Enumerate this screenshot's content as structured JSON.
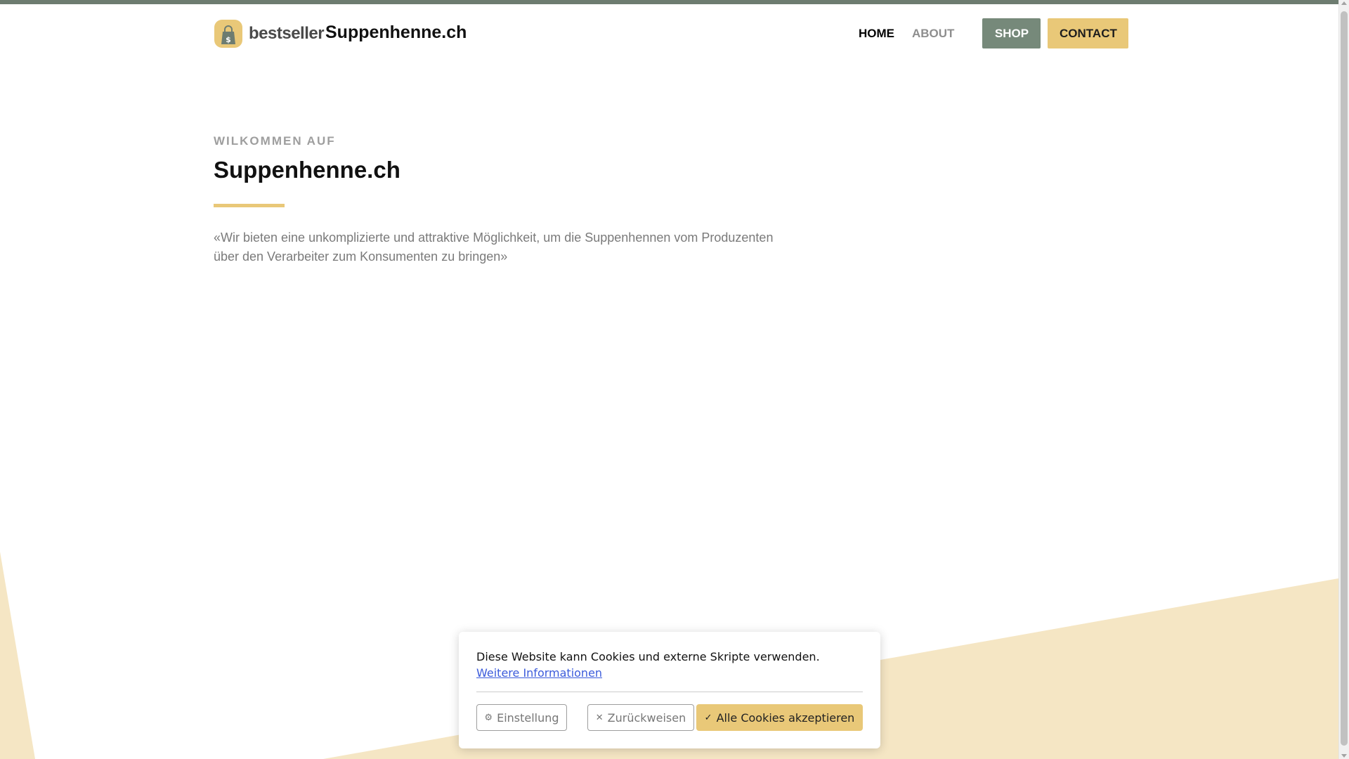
{
  "colors": {
    "topbar": "#6d7c70",
    "accent_gold": "#e9c878",
    "shop_green": "#76897a",
    "bg_shape": "#f5e6c4"
  },
  "header": {
    "logo_word": "bestseller",
    "logo_icon": "shopping-bag-dollar-icon",
    "site_name": "Suppenhenne.ch",
    "nav": {
      "home": "HOME",
      "about": "ABOUT",
      "shop": "SHOP",
      "contact": "CONTACT"
    }
  },
  "hero": {
    "eyebrow": "WILKOMMEN AUF",
    "title": "Suppenhenne.ch",
    "text": "«Wir bieten eine unkomplizierte und attraktive Möglichkeit, um die Suppenhennen vom Produzenten über den Verarbeiter zum Konsumenten zu bringen»"
  },
  "cookie_banner": {
    "message": "Diese Website kann Cookies und externe Skripte verwenden.",
    "more_info": "Weitere Informationen",
    "settings_label": "Einstellung",
    "reject_label": "Zurückweisen",
    "accept_label": "Alle Cookies akzeptieren"
  }
}
